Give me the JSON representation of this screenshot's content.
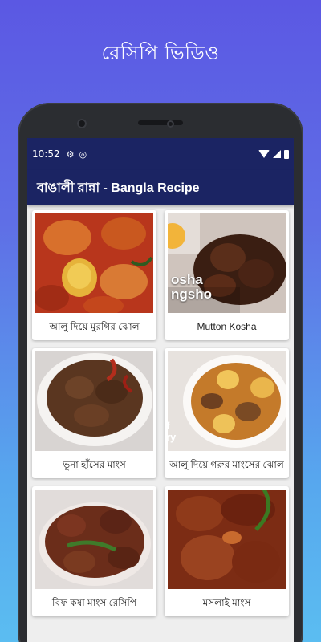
{
  "promo": {
    "title": "রেসিপি ভিডিও"
  },
  "status_bar": {
    "time": "10:52"
  },
  "app_bar": {
    "title": "বাঙালী রান্না - Bangla Recipe"
  },
  "recipes": [
    {
      "label": "আলু দিয়ে মুরগির ঝোল",
      "thumbnail": "chicken-curry-with-potato"
    },
    {
      "label": "Mutton Kosha",
      "thumbnail": "mutton-kosha",
      "overlay": [
        "osha",
        "ngsho"
      ]
    },
    {
      "label": "ভুনা হাঁসের মাংস",
      "thumbnail": "duck-bhuna"
    },
    {
      "label": "আলু দিয়ে গরুর মাংসের ঝোল",
      "thumbnail": "beef-curry-with-potato",
      "overlay": [
        "f",
        "ry"
      ]
    },
    {
      "label": "বিফ কষা মাংস রেসিপি",
      "thumbnail": "beef-kosha"
    },
    {
      "label": "মসলাই মাংস",
      "thumbnail": "masala-meat"
    }
  ],
  "colors": {
    "app_bar": "#1b2463",
    "background_top": "#5b58e3",
    "background_bottom": "#5bbdf1"
  }
}
